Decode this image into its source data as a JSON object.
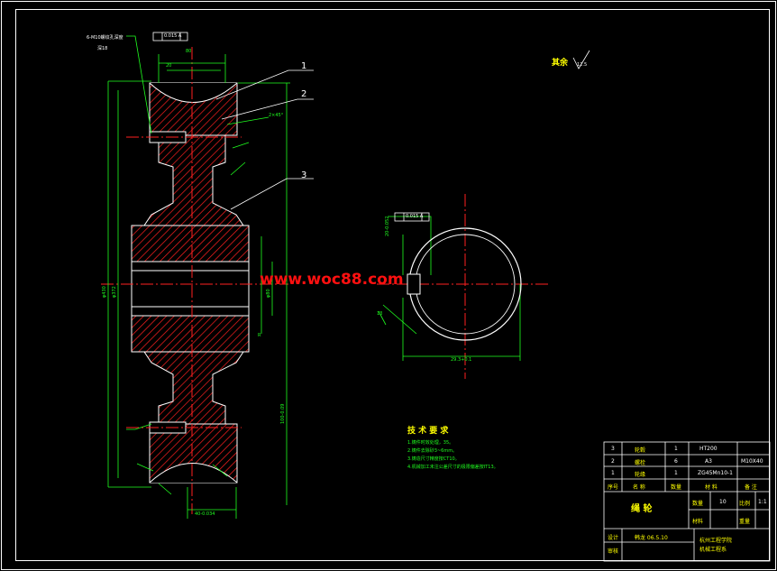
{
  "drawing": {
    "part_numbers": [
      "1",
      "2",
      "3"
    ],
    "surface_roughness_other": "其余",
    "roughness_symbol": "12.5",
    "hole_note": "6-M10螺纹孔深度",
    "hole_note_sub": "深18",
    "dim_chamfer": "2×45°",
    "dim_20": "20",
    "dim_80": "80",
    "dim_gauge": "0.015 A",
    "dim_gauge_2": "0.015 A",
    "dim_keyway_depth": "29.3+0.1",
    "dim_keyway_width": "20-0.052",
    "dim_bore": "40-0.034",
    "dim_hub": "φ80",
    "dim_outer_1": "φ430",
    "dim_outer_2": "φ372",
    "dim_overall": "100-0.09",
    "dim_angle": "13",
    "dim_r": "R"
  },
  "watermark": "www.woc88.com",
  "tech_requirements": {
    "title": "技 术 要 求",
    "items": [
      "1.铸件时效处理，35。",
      "2.铸件去除砂3~6mm。",
      "3.铸造尺寸精度按CT10。",
      "4.机械加工未注公差尺寸的极限偏差按IT13。"
    ]
  },
  "bom": [
    {
      "no": "3",
      "name": "轮毂",
      "qty": "1",
      "material": "HT200",
      "note": "M10X40"
    },
    {
      "no": "2",
      "name": "螺栓",
      "qty": "6",
      "material": "A3",
      "note": ""
    },
    {
      "no": "1",
      "name": "轮缘",
      "qty": "1",
      "material": "ZG45Mn10-1",
      "note": ""
    }
  ],
  "bom_header": {
    "no": "序号",
    "name": "名 称",
    "qty": "数量",
    "material": "材 料",
    "note": "备 注"
  },
  "title_block": {
    "part_name": "绳 轮",
    "qty_label": "数量",
    "qty_value": "10",
    "scale_label": "比例",
    "scale_value": "1:1",
    "material_label": "材料",
    "weight_label": "重量",
    "designer_label": "设计",
    "designer_value": "韩龙  06.5.10",
    "reviewer_label": "审核",
    "school": "杭州工程学院",
    "school_sub": "机械工程系"
  },
  "colors": {
    "outline": "#ffffff",
    "hatch": "#ff2020",
    "dimension": "#1fff1f",
    "text": "#ffff00",
    "centerline": "#ff2020"
  }
}
